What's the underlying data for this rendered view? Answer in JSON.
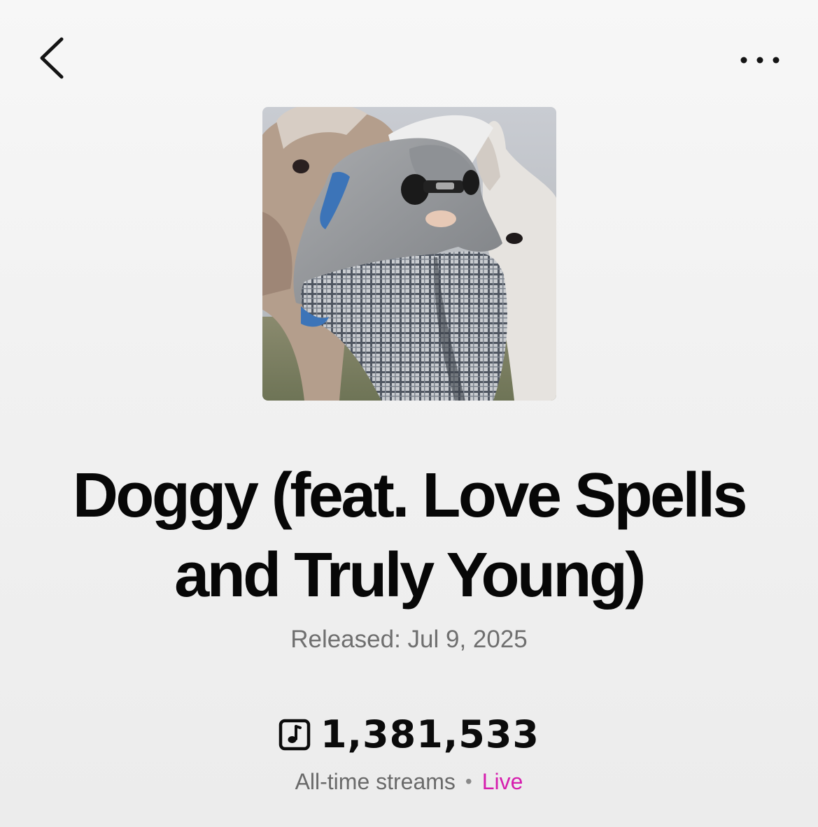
{
  "nav": {
    "back_icon": "chevron-left-icon",
    "more_icon": "more-horizontal-icon"
  },
  "track": {
    "title_line1": "Doggy (feat. Love Spells",
    "title_line2": "and Truly Young)",
    "released": "Released: Jul 9, 2025"
  },
  "stats": {
    "stream_icon": "music-note-square-icon",
    "stream_count": "1,381,533",
    "stream_label": "All-time streams",
    "separator": "•",
    "status": "Live",
    "status_color": "#d61fae"
  }
}
